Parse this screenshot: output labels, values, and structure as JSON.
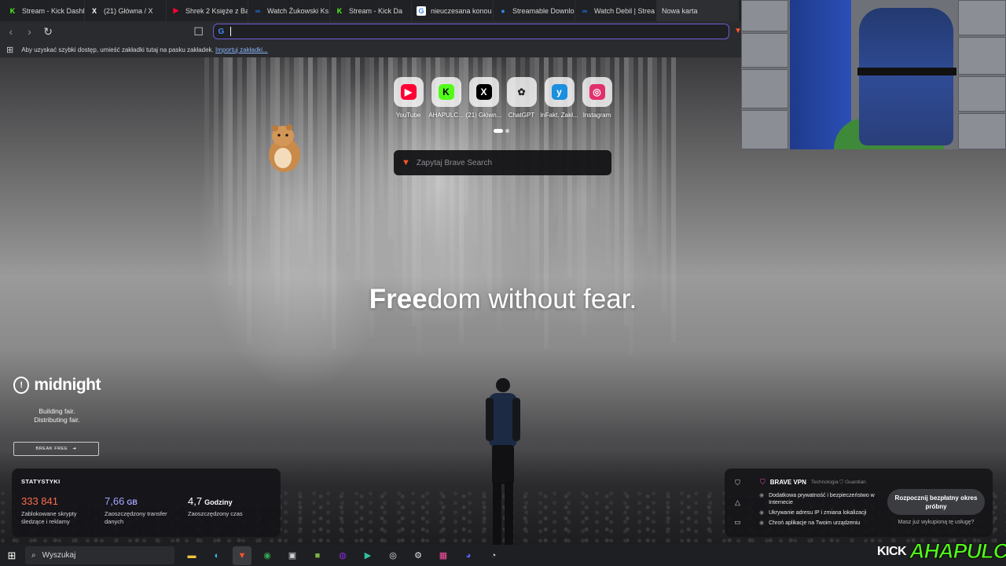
{
  "tabs": [
    {
      "title": "Stream - Kick Dashb",
      "icon": "kick-icon",
      "color": "#53fc18",
      "glyph": "K"
    },
    {
      "title": "(21) Główna / X",
      "icon": "x-icon",
      "color": "#000000",
      "glyph": "X"
    },
    {
      "title": "Shrek 2 Księże z Baj",
      "icon": "youtube-icon",
      "color": "#ff0033",
      "glyph": "▶"
    },
    {
      "title": "Watch Żukowski Ks",
      "icon": "streamable-icon",
      "color": "#1a73e8",
      "glyph": "∞"
    },
    {
      "title": "Stream - Kick Da",
      "icon": "kick-icon",
      "color": "#53fc18",
      "glyph": "K"
    },
    {
      "title": "nieuczesana konou",
      "icon": "google-icon",
      "color": "#ffffff",
      "glyph": "G"
    },
    {
      "title": "Streamable Downlo",
      "icon": "globe-icon",
      "color": "#2d8cff",
      "glyph": "●"
    },
    {
      "title": "Watch Debil | Strea",
      "icon": "streamable-icon",
      "color": "#1a73e8",
      "glyph": "∞"
    },
    {
      "title": "Nowa karta",
      "icon": "",
      "color": "",
      "glyph": ""
    }
  ],
  "bookmarks_bar": {
    "text": "Aby uzyskać szybki dostęp, umieść zakładki tutaj na pasku zakładek.",
    "link": "Importuj zakładki..."
  },
  "top_sites": [
    {
      "label": "YouTube",
      "icon": "youtube-icon",
      "color": "#ff0033",
      "glyph": "▶"
    },
    {
      "label": "AHAPULC...",
      "icon": "kick-icon",
      "color": "#53fc18",
      "glyph": "K"
    },
    {
      "label": "(21) Główn...",
      "icon": "x-icon",
      "color": "#000000",
      "glyph": "X"
    },
    {
      "label": "ChatGPT",
      "icon": "chatgpt-icon",
      "color": "#ffffff",
      "glyph": "✿"
    },
    {
      "label": "inFakt. Zakł...",
      "icon": "infakt-icon",
      "color": "#1b8fe0",
      "glyph": "y"
    },
    {
      "label": "Instagram",
      "icon": "instagram-icon",
      "color": "#e1306c",
      "glyph": "◎"
    }
  ],
  "search": {
    "placeholder": "Zapytaj Brave Search"
  },
  "tagline": {
    "bold": "Free",
    "rest": "dom without fear."
  },
  "sponsor": {
    "name": "midnight",
    "line1": "Building fair.",
    "line2": "Distributing fair.",
    "cta": "BREAK FREE"
  },
  "stats": {
    "heading": "STATYSTYKI",
    "items": [
      {
        "value": "333 841",
        "unit": "",
        "desc": "Zablokowane skrypty śledzące i reklamy",
        "color": "#ff6b4a"
      },
      {
        "value": "7,66",
        "unit": "GB",
        "desc": "Zaoszczędzony transfer danych",
        "color": "#a6a3ff"
      },
      {
        "value": "4,7",
        "unit": "Godziny",
        "desc": "Zaoszczędzony czas",
        "color": "#ffffff"
      }
    ]
  },
  "vpn": {
    "title": "BRAVE VPN",
    "tech": "Technologia",
    "partner": "Guardian",
    "features": [
      "Dodatkowa prywatność i bezpieczeństwo w Internecie",
      "Ukrywanie adresu IP i zmiana lokalizacji",
      "Chroń aplikacje na Twoim urządzeniu"
    ],
    "trial_button": "Rozpocznij bezpłatny okres próbny",
    "already": "Masz już wykupioną tę usługę?"
  },
  "taskbar": {
    "search_label": "Wyszukaj",
    "apps": [
      {
        "name": "file-explorer-icon",
        "glyph": "▬",
        "color": "#f4c542"
      },
      {
        "name": "edge-icon",
        "glyph": "◐",
        "color": "#2ec4e8"
      },
      {
        "name": "brave-icon",
        "glyph": "▼",
        "color": "#fb542b"
      },
      {
        "name": "chrome-icon",
        "glyph": "◉",
        "color": "#34a853"
      },
      {
        "name": "app-icon",
        "glyph": "▣",
        "color": "#cfd3d8"
      },
      {
        "name": "minecraft-icon",
        "glyph": "■",
        "color": "#7cb342"
      },
      {
        "name": "obs-icon",
        "glyph": "◍",
        "color": "#8a2be2"
      },
      {
        "name": "streamlabs-icon",
        "glyph": "▶",
        "color": "#31c3a2"
      },
      {
        "name": "recorder-icon",
        "glyph": "◎",
        "color": "#e0e0e0"
      },
      {
        "name": "settings-icon",
        "glyph": "⚙",
        "color": "#e0e0e0"
      },
      {
        "name": "teams-icon",
        "glyph": "▦",
        "color": "#ff4fa3"
      },
      {
        "name": "discord-icon",
        "glyph": "◕",
        "color": "#5865f2"
      },
      {
        "name": "ghost-icon",
        "glyph": "◔",
        "color": "#e0e0e0"
      }
    ]
  },
  "overlay": {
    "kick": "KICK",
    "channel": "AHAPULCO"
  }
}
